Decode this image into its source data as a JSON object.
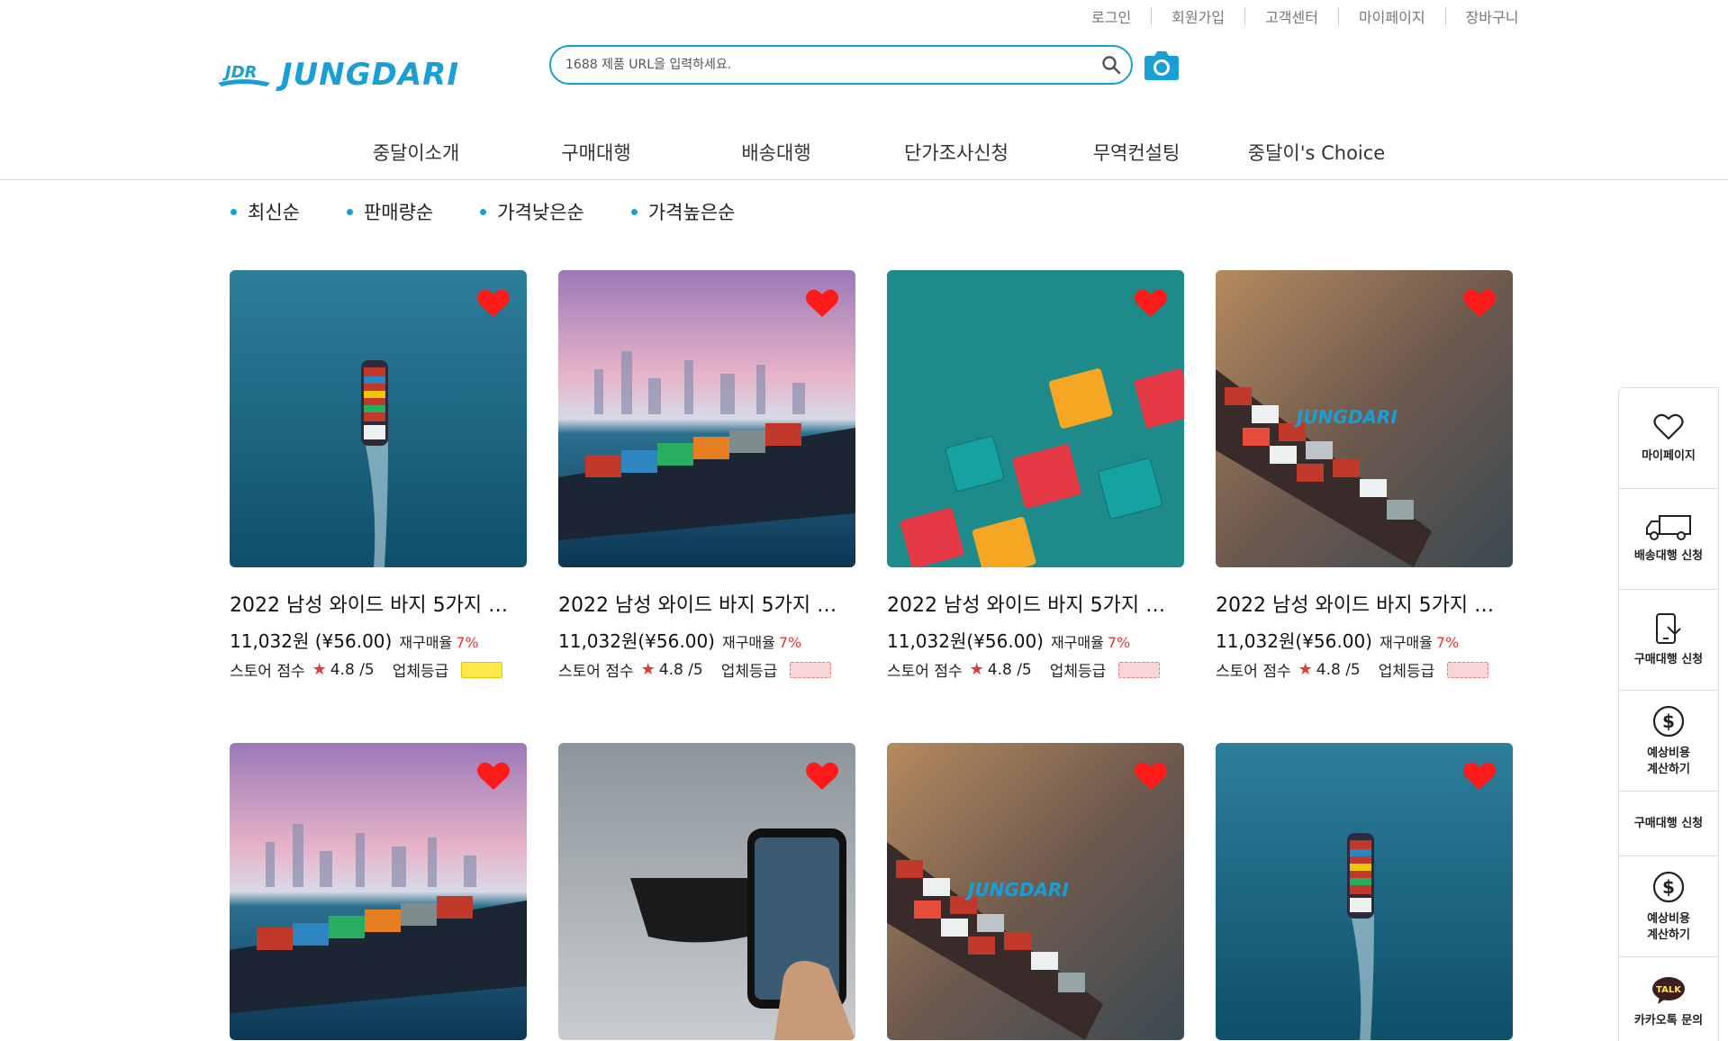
{
  "util_links": [
    "로그인",
    "회원가입",
    "고객센터",
    "마이페이지",
    "장바구니"
  ],
  "logo": {
    "text": "JUNGDARI",
    "mark": "JDR"
  },
  "search": {
    "placeholder": "1688 제품 URL을 입력하세요."
  },
  "nav": [
    "중달이소개",
    "구매대행",
    "배송대행",
    "단가조사신청",
    "무역컨설팅",
    "중달이's Choice"
  ],
  "sort": [
    "최신순",
    "판매량순",
    "가격낮은순",
    "가격높은순"
  ],
  "products": [
    {
      "title": "2022 남성 와이드 바지 5가지 …",
      "price": "11,032원 (¥56.00)",
      "repurchase_label": "재구매율",
      "repurchase": "7%",
      "store_label": "스토어 점수",
      "score": "4.8 /5",
      "grade_label": "업체등급",
      "grade": "gold",
      "image": "ship-aerial"
    },
    {
      "title": "2022 남성 와이드 바지 5가지 …",
      "price": "11,032원(¥56.00)",
      "repurchase_label": "재구매율",
      "repurchase": "7%",
      "store_label": "스토어 점수",
      "score": "4.8 /5",
      "grade_label": "업체등급",
      "grade": "red",
      "image": "ship-city"
    },
    {
      "title": "2022 남성 와이드 바지 5가지 …",
      "price": "11,032원(¥56.00)",
      "repurchase_label": "재구매율",
      "repurchase": "7%",
      "store_label": "스토어 점수",
      "score": "4.8 /5",
      "grade_label": "업체등급",
      "grade": "red",
      "image": "boxes"
    },
    {
      "title": "2022 남성 와이드 바지 5가지 …",
      "price": "11,032원(¥56.00)",
      "repurchase_label": "재구매율",
      "repurchase": "7%",
      "store_label": "스토어 점수",
      "score": "4.8 /5",
      "grade_label": "업체등급",
      "grade": "red",
      "image": "ship-brand"
    },
    {
      "title": "",
      "price": "",
      "repurchase_label": "",
      "repurchase": "",
      "store_label": "",
      "score": "",
      "grade_label": "",
      "grade": "",
      "image": "ship-city"
    },
    {
      "title": "",
      "price": "",
      "repurchase_label": "",
      "repurchase": "",
      "store_label": "",
      "score": "",
      "grade_label": "",
      "grade": "",
      "image": "ship-phone"
    },
    {
      "title": "",
      "price": "",
      "repurchase_label": "",
      "repurchase": "",
      "store_label": "",
      "score": "",
      "grade_label": "",
      "grade": "",
      "image": "ship-brand"
    },
    {
      "title": "",
      "price": "",
      "repurchase_label": "",
      "repurchase": "",
      "store_label": "",
      "score": "",
      "grade_label": "",
      "grade": "",
      "image": "ship-aerial"
    }
  ],
  "quick_menu": [
    {
      "label": "마이페이지",
      "icon": "heart-outline-icon"
    },
    {
      "label": "배송대행 신청",
      "icon": "truck-icon"
    },
    {
      "label": "구매대행 신청",
      "icon": "phone-order-icon"
    },
    {
      "label": "예상비용\n계산하기",
      "icon": "dollar-circle-icon"
    },
    {
      "label": "구매대행 신청",
      "icon": ""
    },
    {
      "label": "예상비용\n계산하기",
      "icon": "dollar-circle-icon"
    },
    {
      "label": "카카오톡 문의",
      "icon": "kakao-talk-icon",
      "icon_text": "TALK"
    }
  ],
  "colors": {
    "accent": "#1a9fd5",
    "heart": "#ff1a1a",
    "repurchase": "#e53935"
  }
}
